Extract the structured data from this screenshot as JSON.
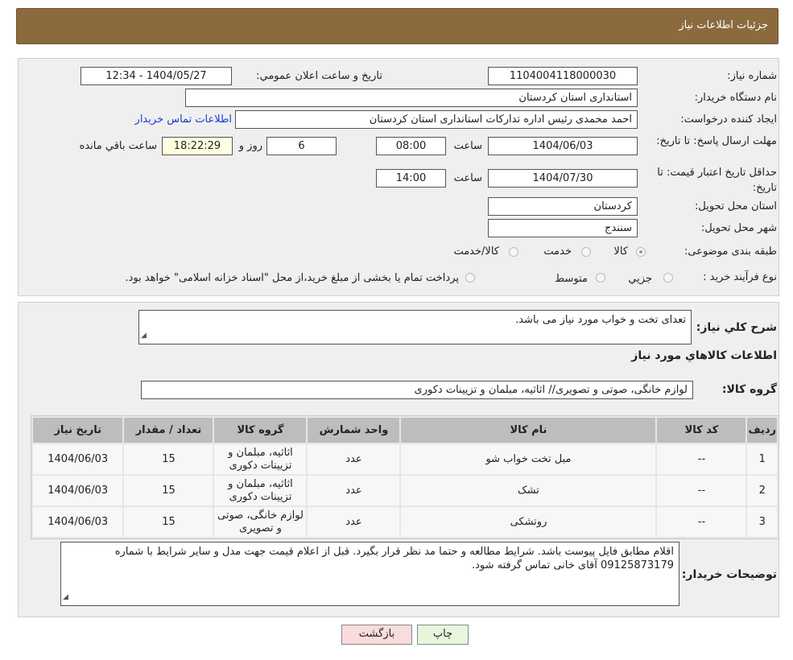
{
  "header": {
    "title": "جزئیات اطلاعات نیاز"
  },
  "form": {
    "need_number_label": "شماره نیاز:",
    "need_number": "1104004118000030",
    "announce_label": "تاریخ و ساعت اعلان عمومي:",
    "announce_value": "1404/05/27 - 12:34",
    "buyer_label": "نام دستگاه خریدار:",
    "buyer": "استانداری استان کردستان",
    "creator_label": "ایجاد کننده درخواست:",
    "creator": "احمد محمدی رئیس اداره تدارکات استانداری استان کردستان",
    "contact_link": "اطلاعات تماس خریدار",
    "deadline_label": "مهلت ارسال پاسخ: تا تاریخ:",
    "deadline_date": "1404/06/03",
    "hour_label": "ساعت",
    "deadline_time": "08:00",
    "days": "6",
    "days_label": "روز و",
    "remaining": "18:22:29",
    "remaining_label": "ساعت باقي مانده",
    "validity_label": "حداقل تاریخ اعتبار قیمت: تا تاریخ:",
    "validity_date": "1404/07/30",
    "validity_time": "14:00",
    "province_label": "استان محل تحویل:",
    "province": "کردستان",
    "city_label": "شهر محل تحویل:",
    "city": "سنندج",
    "category_label": "طبقه بندی موضوعی:",
    "category_options": [
      "کالا",
      "خدمت",
      "کالا/خدمت"
    ],
    "category_selected": "کالا",
    "process_label": "نوع فرآیند خرید :",
    "process_options": [
      "جزيي",
      "متوسط"
    ],
    "process_note": "پرداخت تمام یا بخشی از مبلغ خرید،از محل \"اسناد خزانه اسلامی\" خواهد بود."
  },
  "details": {
    "description_label": "شرح کلي نیاز:",
    "description": "تعدای تخت و خواب مورد نیاز می باشد.",
    "goods_heading": "اطلاعات کالاهاي مورد نیاز",
    "group_label": "گروه کالا:",
    "group": "لوازم خانگی، صوتی و تصویری// اثاثیه، مبلمان و تزیینات دکوری",
    "columns": [
      "ردیف",
      "کد کالا",
      "نام کالا",
      "واحد شمارش",
      "گروه کالا",
      "تعداد / مقدار",
      "تاریخ نیاز"
    ],
    "rows": [
      [
        "1",
        "--",
        "مبل تخت خواب شو",
        "عدد",
        "اثاثیه، مبلمان و تزیینات دکوری",
        "15",
        "1404/06/03"
      ],
      [
        "2",
        "--",
        "تشک",
        "عدد",
        "اثاثیه، مبلمان و تزیینات دکوری",
        "15",
        "1404/06/03"
      ],
      [
        "3",
        "--",
        "روتشکی",
        "عدد",
        "لوازم خانگی، صوتی و تصویری",
        "15",
        "1404/06/03"
      ]
    ],
    "notes_label": "توضیحات خریدار:",
    "notes": "اقلام مطابق فایل پیوست باشد. شرایط مطالعه و حتما مد نظر قرار بگیرد. قبل از اعلام قیمت جهت مدل و سایر شرایط با شماره 09125873179 آقای خانی تماس گرفته شود."
  },
  "buttons": {
    "print": "چاپ",
    "back": "بازگشت"
  }
}
